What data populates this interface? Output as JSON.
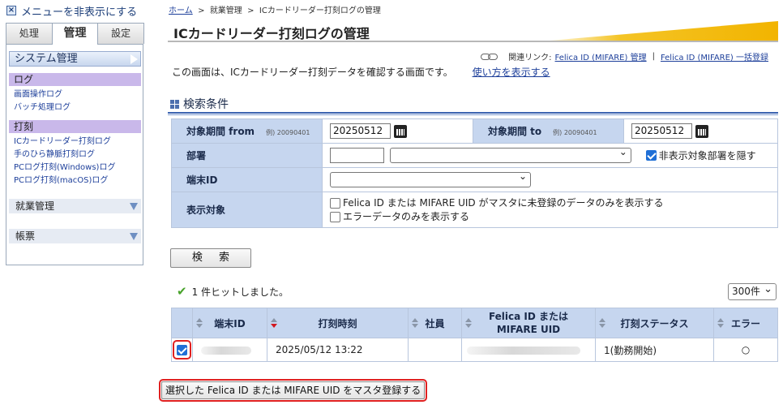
{
  "sidebar": {
    "hide_menu": "メニューを非表示にする",
    "tabs": [
      "処理",
      "管理",
      "設定"
    ],
    "active_tab": "管理",
    "system_header": "システム管理",
    "cat_log": "ログ",
    "log_links": [
      "画面操作ログ",
      "バッチ処理ログ"
    ],
    "cat_stamp": "打刻",
    "stamp_links": [
      "ICカードリーダー打刻ログ",
      "手のひら静脈打刻ログ",
      "PCログ打刻(Windows)ログ",
      "PCログ打刻(macOS)ログ"
    ],
    "section_work": "就業管理",
    "section_report": "帳票"
  },
  "breadcrumb": {
    "home": "ホーム",
    "sep": ">",
    "level2": "就業管理",
    "current": "ICカードリーダー打刻ログの管理"
  },
  "page_title": "ICカードリーダー打刻ログの管理",
  "related": {
    "label": "関連リンク:",
    "link1": "Felica ID (MIFARE) 管理",
    "sep": "|",
    "link2": "Felica ID (MIFARE) 一括登録"
  },
  "description": "この画面は、ICカードリーダー打刻データを確認する画面です。",
  "usage_link": "使い方を表示する",
  "search_conditions": {
    "title": "検索条件",
    "from_label": "対象期間 from",
    "from_example": "例) 20090401",
    "from_value": "20250512",
    "to_label": "対象期間 to",
    "to_example": "例) 20090401",
    "to_value": "20250512",
    "dept_label": "部署",
    "hide_dept_label": "非表示対象部署を隠す",
    "hide_dept_checked": true,
    "terminal_label": "端末ID",
    "display_label": "表示対象",
    "option_unregistered": "Felica ID または MIFARE UID がマスタに未登録のデータのみを表示する",
    "option_error": "エラーデータのみを表示する",
    "search_button": "検 索"
  },
  "results": {
    "hit_text": "1 件ヒットしました。",
    "per_page": "300件",
    "headers": [
      "端末ID",
      "打刻時刻",
      "社員",
      "Felica ID または\nMIFARE UID",
      "打刻ステータス",
      "エラー"
    ],
    "header_line1": "Felica ID または",
    "header_line2": "MIFARE UID",
    "rows": [
      {
        "checked": true,
        "terminal": "",
        "time": "2025/05/12 13:22",
        "employee": "",
        "uid": "",
        "status": "1(勤務開始)",
        "error": "○"
      }
    ]
  },
  "register_button": "選択した Felica ID または MIFARE UID をマスタ登録する",
  "colors": {
    "accent_blue": "#3b63b0",
    "header_blue": "#c6d6ef",
    "category_purple": "#c9b8ea",
    "highlight_red": "#e02020",
    "swoosh_gold": "#f4c426"
  }
}
